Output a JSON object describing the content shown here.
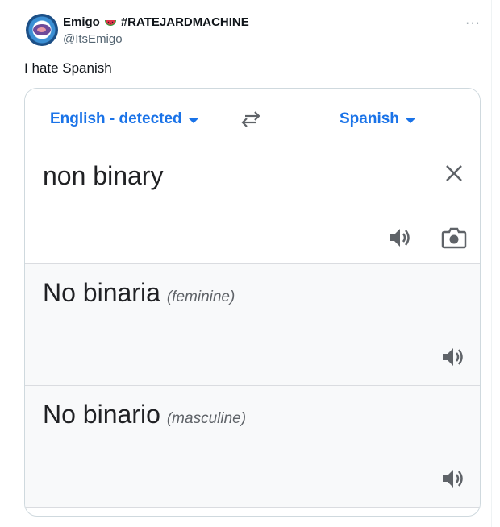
{
  "tweet": {
    "display_name": "Emigo",
    "emoji": "watermelon",
    "hashtag": "#RATEJARDMACHINE",
    "handle": "@ItsEmigo",
    "more": "···",
    "text": "I hate Spanish"
  },
  "translator": {
    "source_language": "English - detected",
    "target_language": "Spanish",
    "source_text": "non binary",
    "results": [
      {
        "text": "No binaria",
        "gender": "(feminine)"
      },
      {
        "text": "No binario",
        "gender": "(masculine)"
      }
    ],
    "accent_color": "#1a73e8"
  }
}
